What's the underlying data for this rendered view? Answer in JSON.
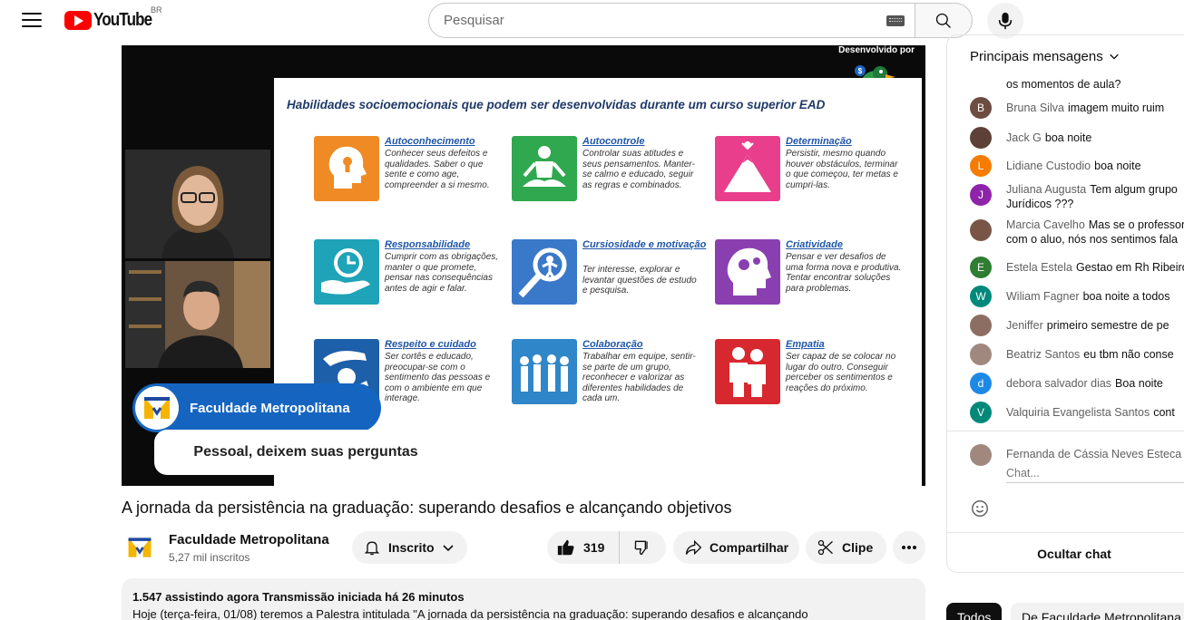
{
  "header": {
    "brand": "YouTube",
    "region": "BR",
    "search_placeholder": "Pesquisar"
  },
  "player": {
    "developed_by": "Desenvolvido por",
    "slide_title": "Habilidades socioemocionais que podem ser desenvolvidas durante um curso superior EAD",
    "skills": [
      {
        "title": "Autoconhecimento",
        "desc": "Conhecer seus defeitos e qualidades. Saber o que sente e como age, compreender a si mesmo.",
        "color": "#f08a24"
      },
      {
        "title": "Autocontrole",
        "desc": "Controlar suas atitudes e seus pensamentos. Manter-se calmo e educado, seguir as regras e combinados.",
        "color": "#2fa84f"
      },
      {
        "title": "Determinação",
        "desc": "Persistir, mesmo quando houver obstáculos, terminar o que começou, ter metas e cumpri-las.",
        "color": "#e83e8c"
      },
      {
        "title": "Responsabilidade",
        "desc": "Cumprir com as obrigações, manter o que promete, pensar nas consequências antes de agir e falar.",
        "color": "#1fa3b8"
      },
      {
        "title": "Cursiosidade e motivação",
        "desc": "Ter interesse, explorar e levantar questões de estudo e pesquisa.",
        "color": "#3a78c9"
      },
      {
        "title": "Criatividade",
        "desc": "Pensar e ver desafios de uma forma nova e produtiva. Tentar encontrar soluções para problemas.",
        "color": "#8a3fb0"
      },
      {
        "title": "Respeito e cuidado",
        "desc": "Ser cortês e educado, preocupar-se com o sentimento das pessoas e com o ambiente em que interage.",
        "color": "#1d5fa8"
      },
      {
        "title": "Colaboração",
        "desc": "Trabalhar em equipe, sentir-se parte de um grupo, reconhecer e valorizar as diferentes habilidades de cada um.",
        "color": "#2f86c9"
      },
      {
        "title": "Empatia",
        "desc": "Ser capaz de se colocar no lugar do outro. Conseguir perceber os sentimentos e reações do próximo.",
        "color": "#d7282f"
      }
    ],
    "chip_name": "Faculdade Metropolitana",
    "subtitle": "Pessoal, deixem suas perguntas"
  },
  "video": {
    "title": "A jornada da persistência na graduação: superando desafios e alcançando objetivos",
    "channel_name": "Faculdade Metropolitana",
    "channel_subs": "5,27 mil inscritos",
    "subscribe_label": "Inscrito",
    "likes": "319",
    "share_label": "Compartilhar",
    "clip_label": "Clipe"
  },
  "description": {
    "meta": "1.547 assistindo agora  Transmissão iniciada há 26 minutos",
    "text": "Hoje (terça-feira, 01/08) teremos a Palestra intitulada \"A jornada da persistência na graduação: superando desafios e alcançando"
  },
  "chat": {
    "header": "Principais mensagens",
    "partial_top": "os momentos de aula?",
    "messages": [
      {
        "author": "Bruna Silva",
        "text": "imagem muito ruim",
        "initial": "B",
        "color": "#6d4c41"
      },
      {
        "author": "Jack G",
        "text": "boa noite",
        "initial": "",
        "color": "#5d4037"
      },
      {
        "author": "Lidiane Custodio",
        "text": "boa noite",
        "initial": "L",
        "color": "#f57c00"
      },
      {
        "author": "Juliana Augusta",
        "text": "Tem algum grupo",
        "text2": "Jurídicos ???",
        "initial": "J",
        "color": "#8e24aa"
      },
      {
        "author": "Marcia Cavelho",
        "text": "Mas se o professor",
        "text2": "com o aluo, nós nos sentimos fala",
        "initial": "",
        "color": "#795548"
      },
      {
        "author": "Estela Estela",
        "text": "Gestao em Rh Ribeiro",
        "initial": "E",
        "color": "#2e7d32"
      },
      {
        "author": "Wiliam Fagner",
        "text": "boa noite a todos",
        "initial": "W",
        "color": "#00897b"
      },
      {
        "author": "Jeniffer",
        "text": "primeiro semestre de pe",
        "initial": "",
        "color": "#8d6e63"
      },
      {
        "author": "Beatriz Santos",
        "text": "eu tbm não conse",
        "initial": "",
        "color": "#a1887f"
      },
      {
        "author": "debora salvador dias",
        "text": "Boa noite",
        "initial": "d",
        "color": "#1e88e5"
      },
      {
        "author": "Valquiria Evangelista Santos",
        "text": "cont",
        "initial": "V",
        "color": "#00897b"
      }
    ],
    "input_user": "Fernanda de Cássia Neves Esteca",
    "input_placeholder": "Chat...",
    "hide_label": "Ocultar chat"
  },
  "tabs": {
    "all": "Todos",
    "channel": "De Faculdade Metropolitana"
  }
}
